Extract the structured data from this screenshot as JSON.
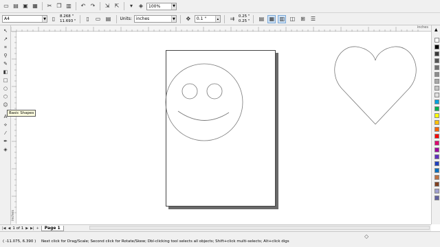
{
  "toolbar": {
    "icons": [
      "new-icon",
      "open-icon",
      "save-icon",
      "print-icon",
      "cut-icon",
      "copy-icon",
      "paste-icon",
      "undo-icon",
      "redo-icon",
      "import-icon",
      "export-icon",
      "app-launcher-icon",
      "corel-online-icon"
    ],
    "zoom": "100%"
  },
  "property_bar": {
    "paper_size": "A4",
    "width": "8.268 \"",
    "height": "11.693 \"",
    "units_label": "Units:",
    "units_value": "inches",
    "nudge": "0.1 \"",
    "dup_x": "0.25 \"",
    "dup_y": "0.25 \""
  },
  "rulers": {
    "unit": "inches"
  },
  "tooltip": "Basic Shapes",
  "page_nav": {
    "page_count": "1 of 1",
    "page_tab": "Page 1"
  },
  "status": {
    "coords": "( -11.075, 6.390 )",
    "hint": "Next click for Drag/Scale; Second click for Rotate/Skew; Dbl-clicking tool selects all objects; Shift+click multi-selects; Alt+click digs"
  },
  "palette": {
    "colors": [
      "#ffffff",
      "#000000",
      "#3a3a3a",
      "#555555",
      "#707070",
      "#8c8c8c",
      "#a8a8a8",
      "#c4c4c4",
      "#e0e0e0",
      "#00a0e0",
      "#00b050",
      "#ffff00",
      "#ffc000",
      "#ff6000",
      "#ff0000",
      "#e00070",
      "#a000a0",
      "#6030c0",
      "#2040c0",
      "#0070c0",
      "#c07040",
      "#804020",
      "#a0a0d0",
      "#6060a0"
    ]
  }
}
